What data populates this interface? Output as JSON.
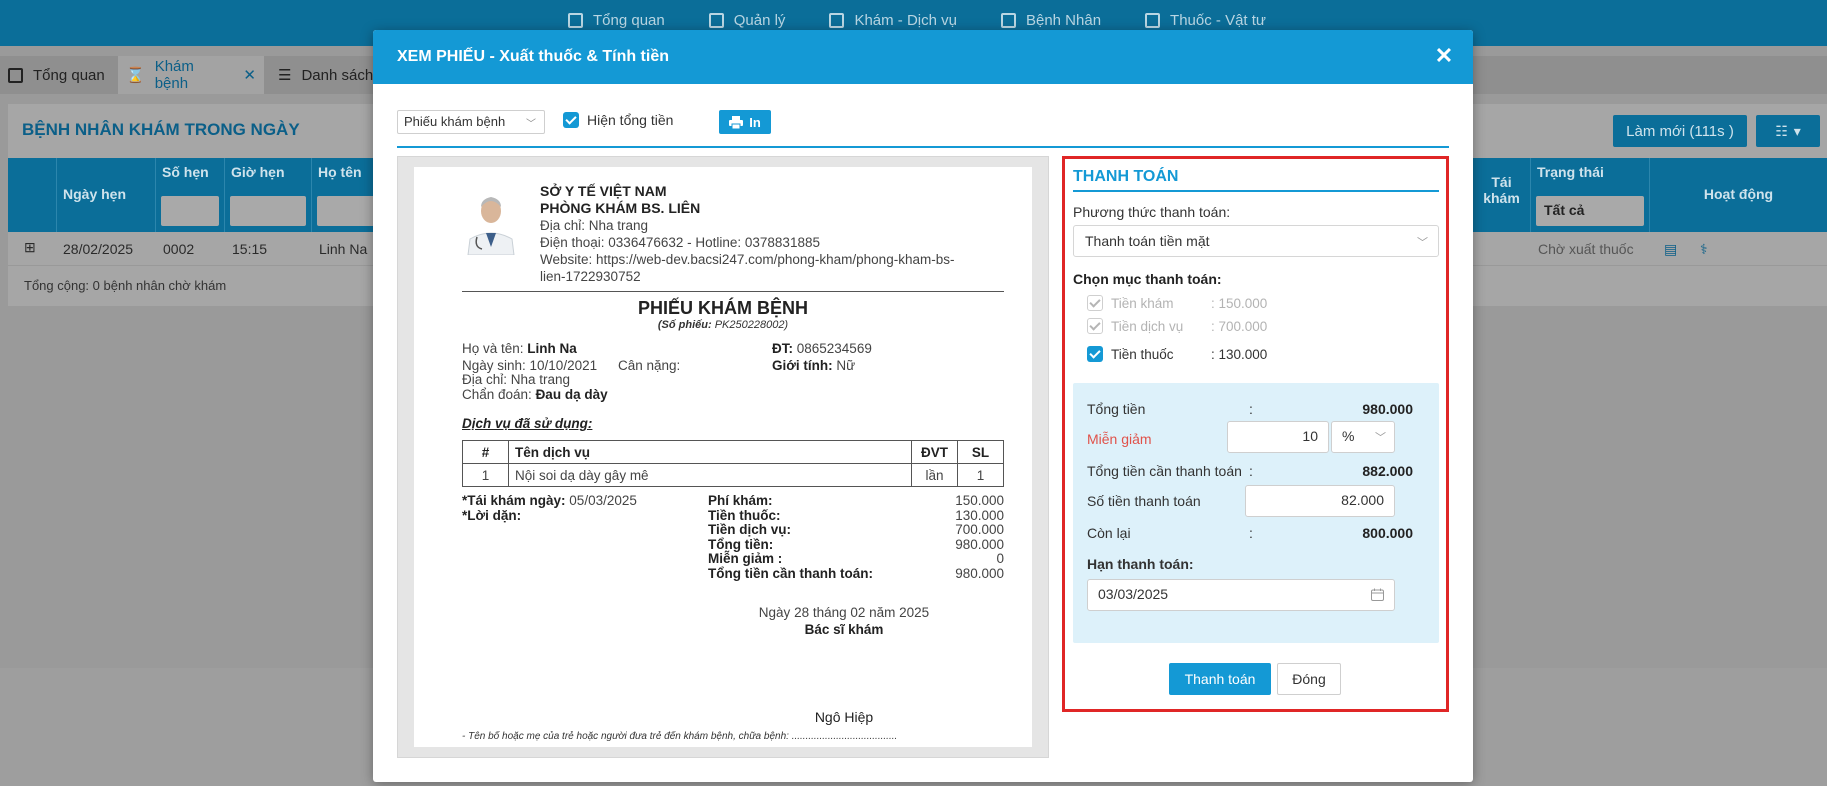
{
  "nav": {
    "items": [
      {
        "label": "Tổng quan",
        "icon": "dashboard-icon"
      },
      {
        "label": "Quản lý",
        "icon": "users-icon"
      },
      {
        "label": "Khám - Dịch vụ",
        "icon": "doctor-icon"
      },
      {
        "label": "Bệnh Nhân",
        "icon": "patient-icon"
      },
      {
        "label": "Thuốc - Vật tư",
        "icon": "medicine-icon"
      }
    ]
  },
  "tabs": [
    {
      "label": "Tổng quan"
    },
    {
      "label": "Khám bệnh"
    },
    {
      "label": "Danh sách"
    }
  ],
  "list": {
    "title": "BỆNH NHÂN KHÁM TRONG NGÀY",
    "refresh_label": "Làm mới (111s )",
    "columns": {
      "ngay_hen": "Ngày hẹn",
      "so_hen": "Số hẹn",
      "gio_hen": "Giờ hẹn",
      "ho_ten": "Họ tên",
      "tai_kham": "Tái khám",
      "trang_thai": "Trạng thái",
      "hoat_dong": "Hoạt động"
    },
    "status_filter": "Tất cả",
    "row": {
      "ngay_hen": "28/02/2025",
      "so_hen": "0002",
      "gio_hen": "15:15",
      "ho_ten": "Linh Na",
      "trang_thai": "Chờ xuất thuốc"
    },
    "total_text": "Tổng cộng: 0 bệnh nhân chờ khám"
  },
  "modal": {
    "title": "XEM PHIẾU - Xuất thuốc & Tính tiền",
    "doc_type": "Phiếu khám bệnh",
    "show_total_label": "Hiện tổng tiền",
    "print_label": "In"
  },
  "receipt": {
    "org": "SỞ Y TẾ VIỆT NAM",
    "clinic": "PHÒNG KHÁM BS. LIÊN",
    "address": "Địa chỉ: Nha trang",
    "phone": "Điện thoại: 0336476632 - Hotline: 0378831885",
    "website1": "Website: https://web-dev.bacsi247.com/phong-kham/phong-kham-bs-",
    "website2": "lien-1722930752",
    "title": "PHIẾU KHÁM BỆNH",
    "no_label": "(Số phiếu: ",
    "no_value": "PK250228002)",
    "name_label": "Họ và tên: ",
    "name_value": "Linh Na",
    "dob": "Ngày sinh: 10/10/2021",
    "weight": "Cân nặng:",
    "addr": "Địa chỉ: Nha trang",
    "diag_label": "Chẩn đoán: ",
    "diag_value": "Đau dạ dày",
    "phone_label": "ĐT: ",
    "phone_value": "0865234569",
    "gender_label": "Giới tính: ",
    "gender_value": "Nữ",
    "services_title": "Dịch vụ đã sử dụng:",
    "svc_headers": [
      "#",
      "Tên dịch vụ",
      "ĐVT",
      "SL"
    ],
    "svc_rows": [
      [
        "1",
        "Nội soi dạ dày gây mê",
        "lần",
        "1"
      ]
    ],
    "recheck_label": "*Tái khám ngày: ",
    "recheck_value": "05/03/2025",
    "advice_label": "*Lời dặn:",
    "sums": [
      {
        "label": "Phí khám:",
        "value": "150.000"
      },
      {
        "label": "Tiền thuốc:",
        "value": "130.000"
      },
      {
        "label": "Tiền dịch vụ:",
        "value": "700.000"
      },
      {
        "label": "Tổng tiền:",
        "value": "980.000"
      },
      {
        "label": "Miễn giảm :",
        "value": "0"
      },
      {
        "label": "Tổng tiền cần thanh toán:",
        "value": "980.000"
      }
    ],
    "sign_date": "Ngày 28 tháng 02 năm 2025",
    "sign_role": "Bác sĩ khám",
    "sign_name": "Ngô Hiệp",
    "footnote": "- Tên bố hoặc mẹ của trẻ hoặc người đưa trẻ đến khám bệnh, chữa bệnh: ......................................"
  },
  "payment": {
    "title": "THANH TOÁN",
    "method_label": "Phương thức thanh toán:",
    "method_value": "Thanh toán tiền mặt",
    "items_label": "Chọn mục thanh toán:",
    "items": [
      {
        "label": "Tiền khám",
        "amount": ": 150.000",
        "checked": true,
        "disabled": true
      },
      {
        "label": "Tiền dịch vụ",
        "amount": ": 700.000",
        "checked": true,
        "disabled": true
      },
      {
        "label": "Tiền thuốc",
        "amount": ": 130.000",
        "checked": true,
        "disabled": false
      }
    ],
    "total_label": "Tổng tiền",
    "total_value": "980.000",
    "discount_label": "Miễn giảm",
    "discount_value": "10",
    "discount_unit": "%",
    "need_label": "Tổng tiền cần thanh toán",
    "need_value": "882.000",
    "paid_label": "Số tiền thanh toán",
    "paid_value": "82.000",
    "remain_label": "Còn lại",
    "remain_value": "800.000",
    "due_label": "Hạn thanh toán:",
    "due_value": "03/03/2025",
    "pay_button": "Thanh toán",
    "close_button": "Đóng",
    "colon": ":"
  },
  "colors": {
    "primary": "#1499d5",
    "highlight_border": "#e02626",
    "discount_label": "#e0524a",
    "calc_bg": "#ddf1fa"
  }
}
